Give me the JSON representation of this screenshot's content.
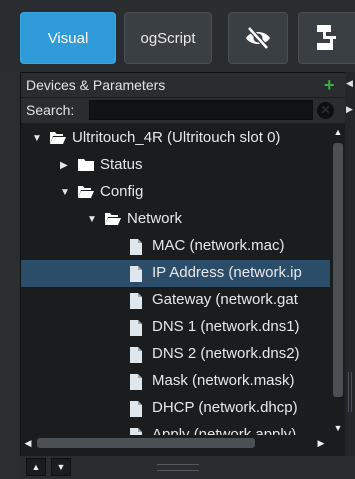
{
  "tabs": [
    {
      "label": "Visual",
      "active": true
    },
    {
      "label": "ogScript",
      "active": false
    },
    {
      "icon": "eye-slash-icon"
    },
    {
      "icon": "flowchart-icon"
    }
  ],
  "panel": {
    "title": "Devices & Parameters",
    "add_icon": "plus-icon",
    "search": {
      "label": "Search:",
      "value": "",
      "clear_icon": "clear-circle-icon"
    }
  },
  "tree": {
    "items": [
      {
        "label": "Ultritouch_4R (Ultritouch slot 0)",
        "kind": "folder-open",
        "expanded": true,
        "level": 0
      },
      {
        "label": "Status",
        "kind": "folder",
        "expanded": false,
        "level": 1
      },
      {
        "label": "Config",
        "kind": "folder-open",
        "expanded": true,
        "level": 1
      },
      {
        "label": "Network",
        "kind": "folder-open",
        "expanded": true,
        "level": 2
      },
      {
        "label": "MAC (network.mac)",
        "kind": "file",
        "level": 3
      },
      {
        "label": "IP Address (network.ip",
        "kind": "file",
        "level": 3,
        "selected": true
      },
      {
        "label": "Gateway (network.gat",
        "kind": "file",
        "level": 3
      },
      {
        "label": "DNS 1 (network.dns1)",
        "kind": "file",
        "level": 3
      },
      {
        "label": "DNS 2 (network.dns2)",
        "kind": "file",
        "level": 3
      },
      {
        "label": "Mask (network.mask)",
        "kind": "file",
        "level": 3
      },
      {
        "label": "DHCP (network.dhcp)",
        "kind": "file",
        "level": 3
      },
      {
        "label": "Apply (network.apply)",
        "kind": "file",
        "level": 3
      }
    ]
  },
  "colors": {
    "accent": "#2f9bd8",
    "selection": "#2c4d6a",
    "add": "#3ab23a"
  }
}
